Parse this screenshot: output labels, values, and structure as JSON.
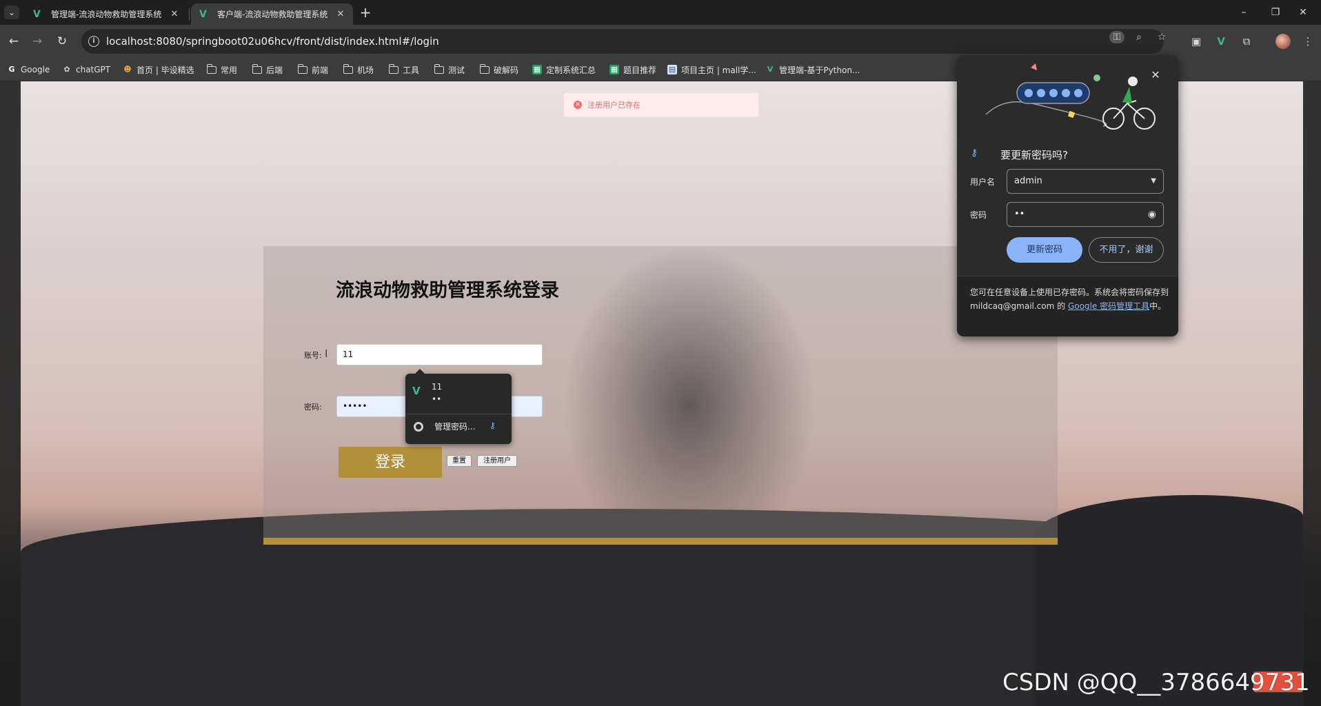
{
  "browser": {
    "tabs": [
      {
        "title": "管理端-流浪动物救助管理系统",
        "favicon": "vue-logo-icon",
        "active": false
      },
      {
        "title": "客户端-流浪动物救助管理系统",
        "favicon": "vue-logo-icon",
        "active": true
      }
    ],
    "url": "localhost:8080/springboot02u06hcv/front/dist/index.html#/login",
    "bookmarks": [
      {
        "label": "Google",
        "icon": "google-icon"
      },
      {
        "label": "chatGPT",
        "icon": "openai-icon"
      },
      {
        "label": "首页 | 毕设精选",
        "icon": "site-icon"
      },
      {
        "label": "常用",
        "icon": "folder-icon"
      },
      {
        "label": "后端",
        "icon": "folder-icon"
      },
      {
        "label": "前端",
        "icon": "folder-icon"
      },
      {
        "label": "机场",
        "icon": "folder-icon"
      },
      {
        "label": "工具",
        "icon": "folder-icon"
      },
      {
        "label": "测试",
        "icon": "folder-icon"
      },
      {
        "label": "破解码",
        "icon": "folder-icon"
      },
      {
        "label": "定制系统汇总",
        "icon": "sheet-icon"
      },
      {
        "label": "题目推荐",
        "icon": "sheet-icon"
      },
      {
        "label": "项目主页 | mall学...",
        "icon": "page-icon"
      },
      {
        "label": "管理端-基于Python...",
        "icon": "vue-logo-icon"
      }
    ]
  },
  "toast": {
    "message": "注册用户已存在",
    "color": "#f56c6c"
  },
  "login": {
    "title": "流浪动物救助管理系统登录",
    "account_label": "账号:",
    "account_value": "11",
    "password_label": "密码:",
    "password_value": "•••••",
    "login_button": "登录",
    "reset_button": "重置",
    "register_button": "注册用户",
    "accent_color": "#b38f3a"
  },
  "autofill": {
    "username": "11",
    "password_mask": "••",
    "manage_label": "管理密码..."
  },
  "password_bubble": {
    "title": "要更新密码吗?",
    "username_label": "用户名",
    "username_value": "admin",
    "password_label": "密码",
    "password_value": "••",
    "update_button": "更新密码",
    "decline_button": "不用了，谢谢",
    "footer_text": "您可在任意设备上使用已存密码。系统会将密码保存到 mildcaq@gmail.com 的 ",
    "footer_link": "Google 密码管理工具",
    "footer_end": "中。"
  },
  "watermark": {
    "text": "CSDN @QQ__3786649731"
  }
}
